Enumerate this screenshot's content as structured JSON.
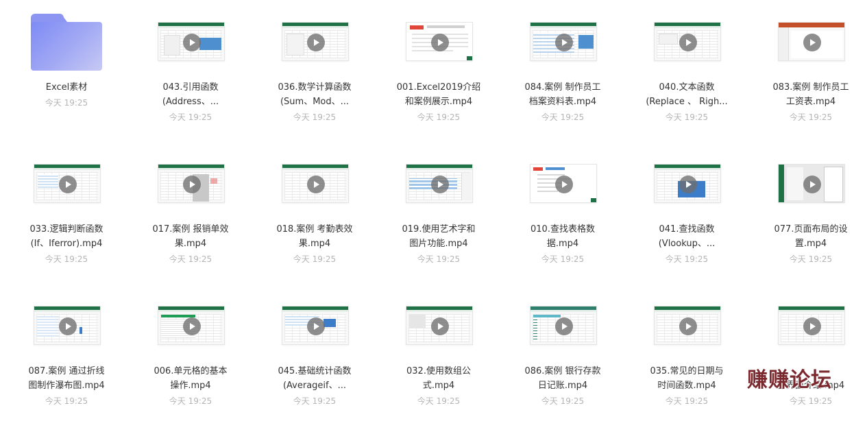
{
  "items": [
    {
      "line1": "Excel素材",
      "line2": "",
      "time": "今天 19:25",
      "kind": "folder"
    },
    {
      "line1": "043.引用函数",
      "line2": "(Address、...",
      "time": "今天 19:25",
      "kind": "video"
    },
    {
      "line1": "036.数学计算函数",
      "line2": "(Sum、Mod、...",
      "time": "今天 19:25",
      "kind": "video"
    },
    {
      "line1": "001.Excel2019介绍",
      "line2": "和案例展示.mp4",
      "time": "今天 19:25",
      "kind": "video"
    },
    {
      "line1": "084.案例 制作员工",
      "line2": "档案资料表.mp4",
      "time": "今天 19:25",
      "kind": "video"
    },
    {
      "line1": "040.文本函数",
      "line2": "(Replace 、 Righ...",
      "time": "今天 19:25",
      "kind": "video"
    },
    {
      "line1": "083.案例 制作员工",
      "line2": "工资表.mp4",
      "time": "今天 19:25",
      "kind": "video"
    },
    {
      "line1": "033.逻辑判断函数",
      "line2": "(If、Iferror).mp4",
      "time": "今天 19:25",
      "kind": "video"
    },
    {
      "line1": "017.案例 报销单效",
      "line2": "果.mp4",
      "time": "今天 19:25",
      "kind": "video"
    },
    {
      "line1": "018.案例 考勤表效",
      "line2": "果.mp4",
      "time": "今天 19:25",
      "kind": "video"
    },
    {
      "line1": "019.使用艺术字和",
      "line2": "图片功能.mp4",
      "time": "今天 19:25",
      "kind": "video"
    },
    {
      "line1": "010.查找表格数",
      "line2": "据.mp4",
      "time": "今天 19:25",
      "kind": "video"
    },
    {
      "line1": "041.查找函数",
      "line2": "(Vlookup、...",
      "time": "今天 19:25",
      "kind": "video"
    },
    {
      "line1": "077.页面布局的设",
      "line2": "置.mp4",
      "time": "今天 19:25",
      "kind": "video"
    },
    {
      "line1": "087.案例 通过折线",
      "line2": "图制作瀑布图.mp4",
      "time": "今天 19:25",
      "kind": "video"
    },
    {
      "line1": "006.单元格的基本",
      "line2": "操作.mp4",
      "time": "今天 19:25",
      "kind": "video"
    },
    {
      "line1": "045.基础统计函数",
      "line2": "(Averageif、...",
      "time": "今天 19:25",
      "kind": "video"
    },
    {
      "line1": "032.使用数组公",
      "line2": "式.mp4",
      "time": "今天 19:25",
      "kind": "video"
    },
    {
      "line1": "086.案例 银行存款",
      "line2": "日记账.mp4",
      "time": "今天 19:25",
      "kind": "video"
    },
    {
      "line1": "035.常见的日期与",
      "line2": "时间函数.mp4",
      "time": "今天 19:25",
      "kind": "video"
    },
    {
      "line1": "",
      "line2": "作界面介绍.mp4",
      "time": "今天 19:25",
      "kind": "video"
    }
  ],
  "watermark": "赚赚论坛",
  "colors": {
    "excel_ribbon": "#1f7245",
    "folder": "#8d95f2",
    "time_text": "#b4b4b4",
    "label_text": "#333333"
  }
}
